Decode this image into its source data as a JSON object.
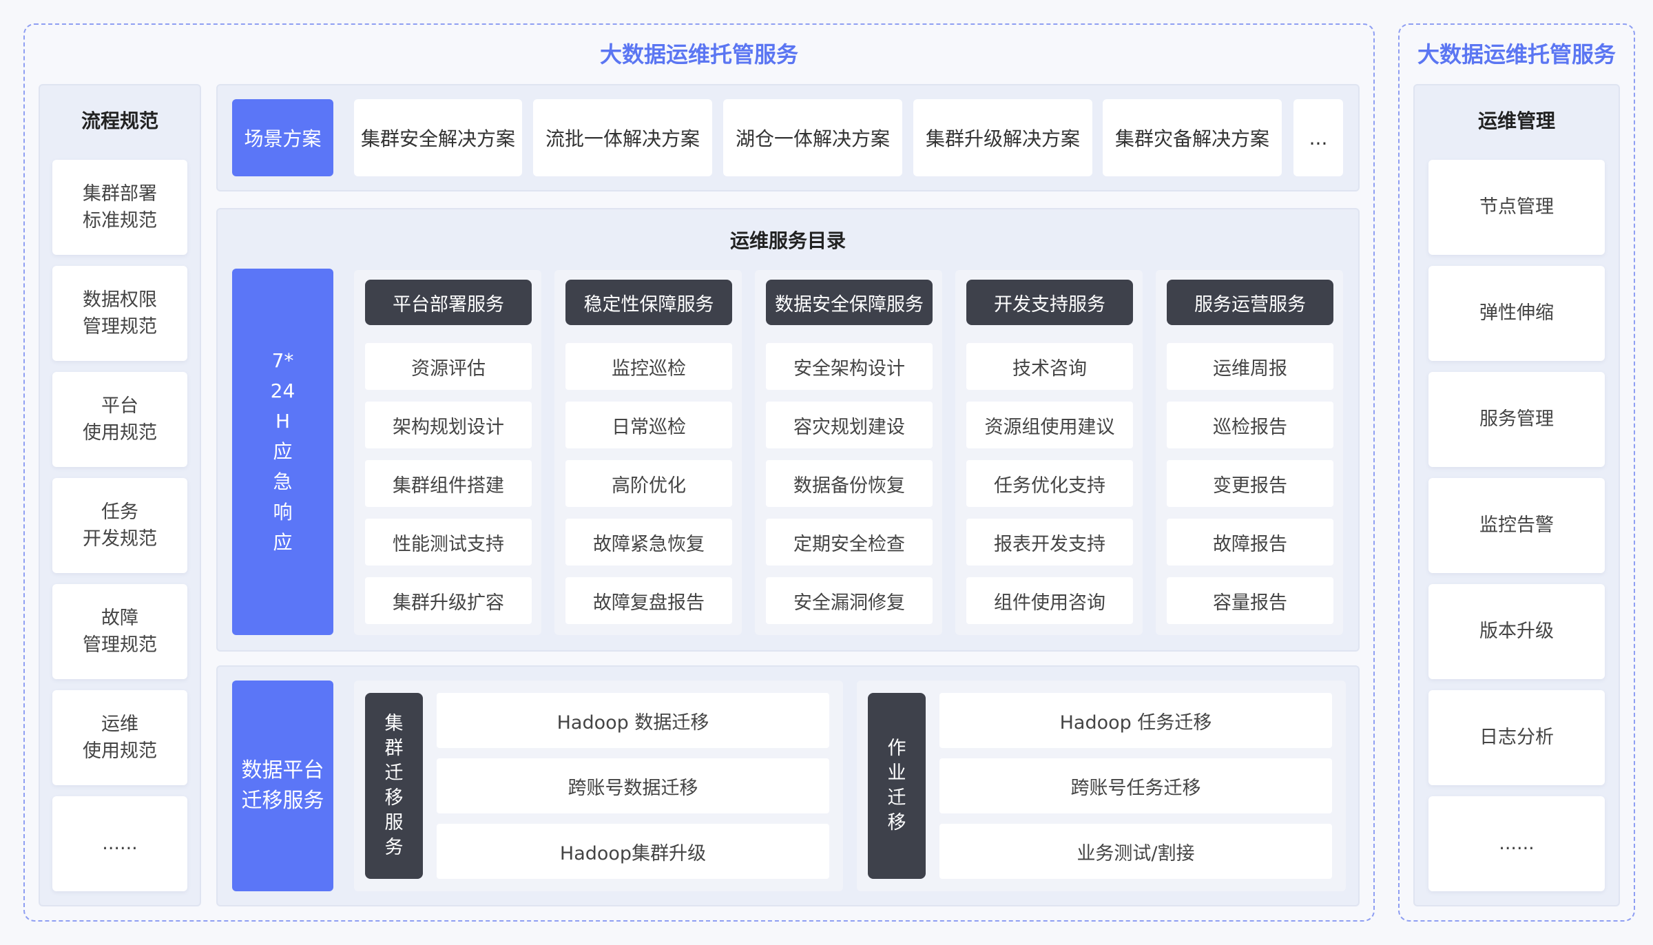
{
  "main_title": "大数据运维托管服务",
  "right_title": "大数据运维托管服务",
  "left_panel": {
    "title": "流程规范",
    "items": [
      "集群部署\n标准规范",
      "数据权限\n管理规范",
      "平台\n使用规范",
      "任务\n开发规范",
      "故障\n管理规范",
      "运维\n使用规范",
      "......"
    ]
  },
  "right_panel": {
    "title": "运维管理",
    "items": [
      "节点管理",
      "弹性伸缩",
      "服务管理",
      "监控告警",
      "版本升级",
      "日志分析",
      "......"
    ]
  },
  "scene": {
    "label": "场景方案",
    "items": [
      "集群安全解决方案",
      "流批一体解决方案",
      "湖仓一体解决方案",
      "集群升级解决方案",
      "集群灾备解决方案",
      "..."
    ]
  },
  "catalog": {
    "title": "运维服务目录",
    "emergency": "7*\n24\nH\n应\n急\n响\n应",
    "columns": [
      {
        "header": "平台部署服务",
        "items": [
          "资源评估",
          "架构规划设计",
          "集群组件搭建",
          "性能测试支持",
          "集群升级扩容"
        ]
      },
      {
        "header": "稳定性保障服务",
        "items": [
          "监控巡检",
          "日常巡检",
          "高阶优化",
          "故障紧急恢复",
          "故障复盘报告"
        ]
      },
      {
        "header": "数据安全保障服务",
        "items": [
          "安全架构设计",
          "容灾规划建设",
          "数据备份恢复",
          "定期安全检查",
          "安全漏洞修复"
        ]
      },
      {
        "header": "开发支持服务",
        "items": [
          "技术咨询",
          "资源组使用建议",
          "任务优化支持",
          "报表开发支持",
          "组件使用咨询"
        ]
      },
      {
        "header": "服务运营服务",
        "items": [
          "运维周报",
          "巡检报告",
          "变更报告",
          "故障报告",
          "容量报告"
        ]
      }
    ]
  },
  "migration": {
    "label": "数据平台\n迁移服务",
    "groups": [
      {
        "label": "集\n群\n迁\n移\n服\n务",
        "items": [
          "Hadoop 数据迁移",
          "跨账号数据迁移",
          "Hadoop集群升级"
        ]
      },
      {
        "label": "作\n业\n迁\n移",
        "items": [
          "Hadoop 任务迁移",
          "跨账号任务迁移",
          "业务测试/割接"
        ]
      }
    ]
  },
  "colors": {
    "accent_blue": "#5b76f7",
    "dark_header": "#3e414b",
    "dashed_border": "#8e9ef2"
  }
}
